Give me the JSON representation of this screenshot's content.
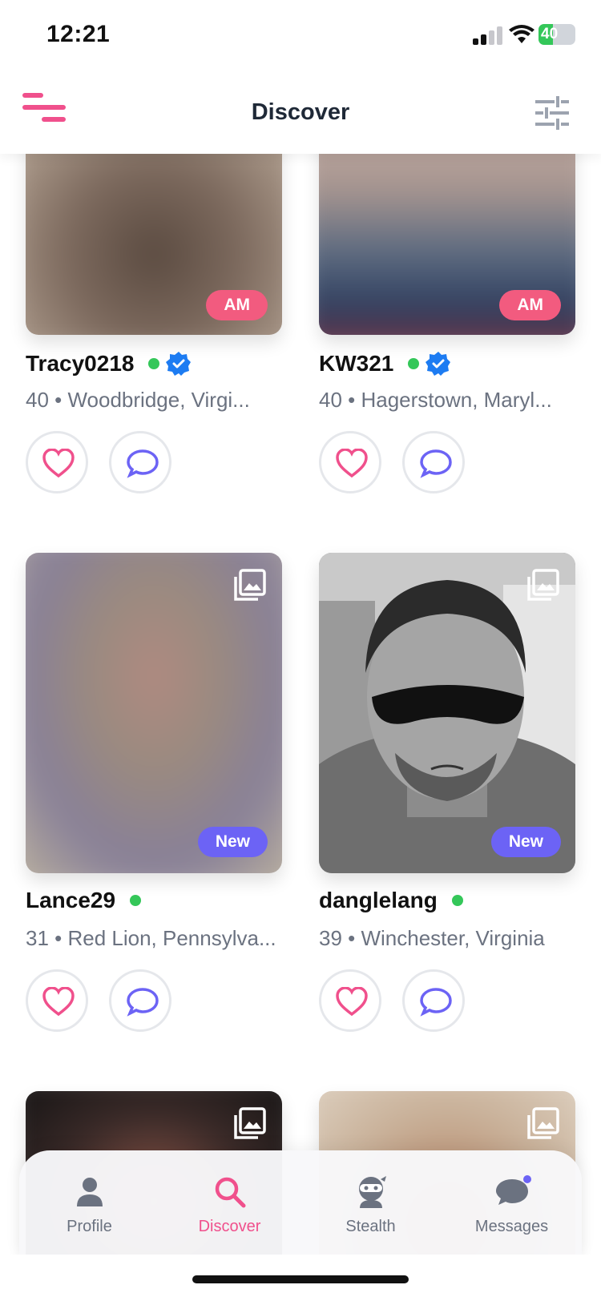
{
  "status_bar": {
    "time": "12:21",
    "battery": "40",
    "battery_level": 0.4
  },
  "header": {
    "title": "Discover"
  },
  "cards": [
    {
      "name": "Tracy0218",
      "meta": "40 • Woodbridge, Virgi...",
      "badge": "AM",
      "online": true,
      "verified": true
    },
    {
      "name": "KW321",
      "meta": "40 • Hagerstown, Maryl...",
      "badge": "AM",
      "online": true,
      "verified": true
    },
    {
      "name": "Lance29",
      "meta": "31 • Red Lion, Pennsylva...",
      "badge": "New",
      "online": true,
      "verified": false
    },
    {
      "name": "danglelang",
      "meta": "39 • Winchester, Virginia",
      "badge": "New",
      "online": true,
      "verified": false
    }
  ],
  "bottom_nav": [
    {
      "label": "Profile",
      "icon": "person-icon",
      "active": false
    },
    {
      "label": "Discover",
      "icon": "search-icon",
      "active": true
    },
    {
      "label": "Stealth",
      "icon": "ninja-icon",
      "active": false
    },
    {
      "label": "Messages",
      "icon": "chat-bubble-icon",
      "active": false,
      "has_notification": true
    }
  ],
  "colors": {
    "accent": "#f0508c",
    "secondary": "#6c63f5",
    "online": "#34c759",
    "verified": "#1d7cf2"
  }
}
